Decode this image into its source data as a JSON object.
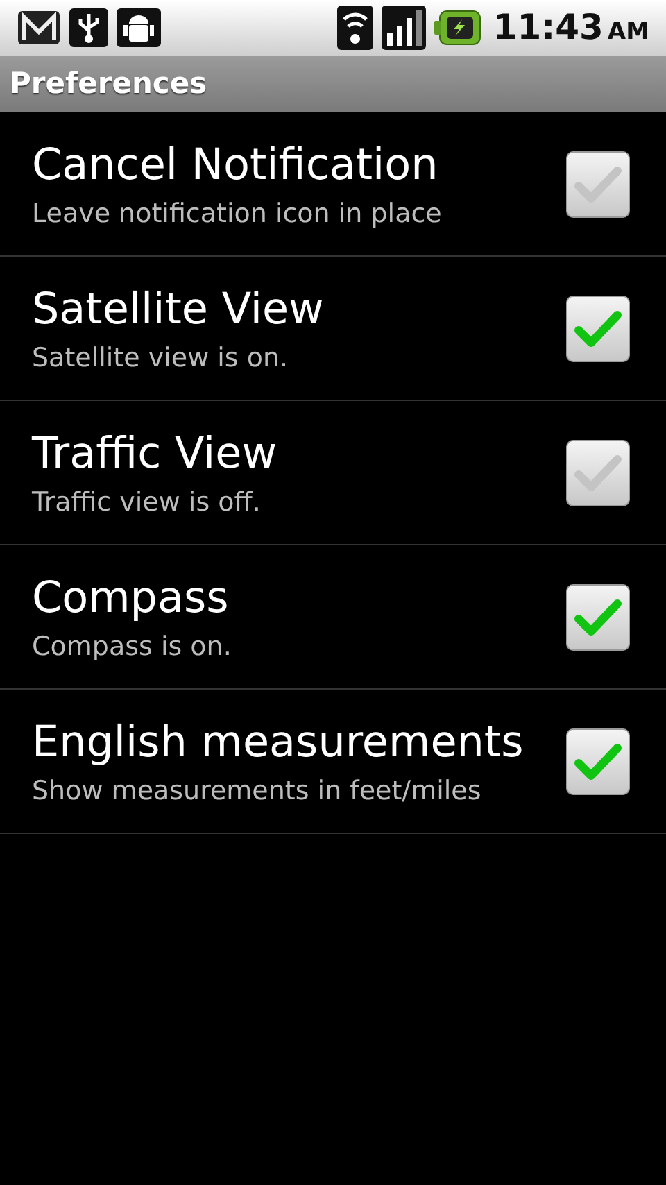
{
  "status_bar": {
    "time": "11:43",
    "period": "AM"
  },
  "title_bar": {
    "title": "Preferences"
  },
  "preferences": [
    {
      "title": "Cancel Notification",
      "summary": "Leave notification icon in place",
      "checked": false
    },
    {
      "title": "Satellite View",
      "summary": "Satellite view is on.",
      "checked": true
    },
    {
      "title": "Traffic View",
      "summary": "Traffic view is off.",
      "checked": false
    },
    {
      "title": "Compass",
      "summary": "Compass is on.",
      "checked": true
    },
    {
      "title": "English measurements",
      "summary": "Show measurements in feet/miles",
      "checked": true
    }
  ]
}
